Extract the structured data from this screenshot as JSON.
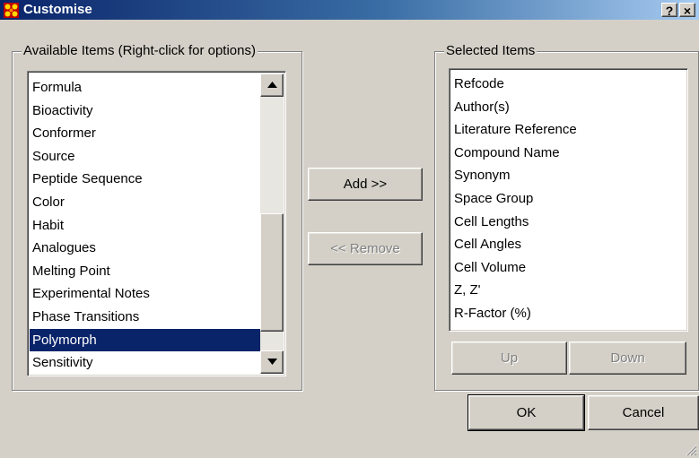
{
  "window": {
    "title": "Customise"
  },
  "titlebar_buttons": {
    "help": "?",
    "close": "×"
  },
  "available": {
    "legend": "Available Items (Right-click for options)",
    "items": [
      "Formula",
      "Bioactivity",
      "Conformer",
      "Source",
      "Peptide Sequence",
      "Color",
      "Habit",
      "Analogues",
      "Melting Point",
      "Experimental Notes",
      "Phase Transitions",
      "Polymorph",
      "Sensitivity"
    ],
    "selected_item": "Polymorph"
  },
  "selected": {
    "legend": "Selected Items",
    "items": [
      "Refcode",
      "Author(s)",
      "Literature Reference",
      "Compound Name",
      "Synonym",
      "Space Group",
      "Cell Lengths",
      "Cell Angles",
      "Cell Volume",
      "Z, Z'",
      "R-Factor (%)"
    ]
  },
  "buttons": {
    "add": "Add >>",
    "remove": "<< Remove",
    "up": "Up",
    "down": "Down",
    "ok": "OK",
    "cancel": "Cancel"
  },
  "colors": {
    "title_gradient_start": "#0a246a",
    "title_gradient_end": "#a6caf0",
    "face": "#d4d0c8",
    "highlight": "#0a246a"
  }
}
